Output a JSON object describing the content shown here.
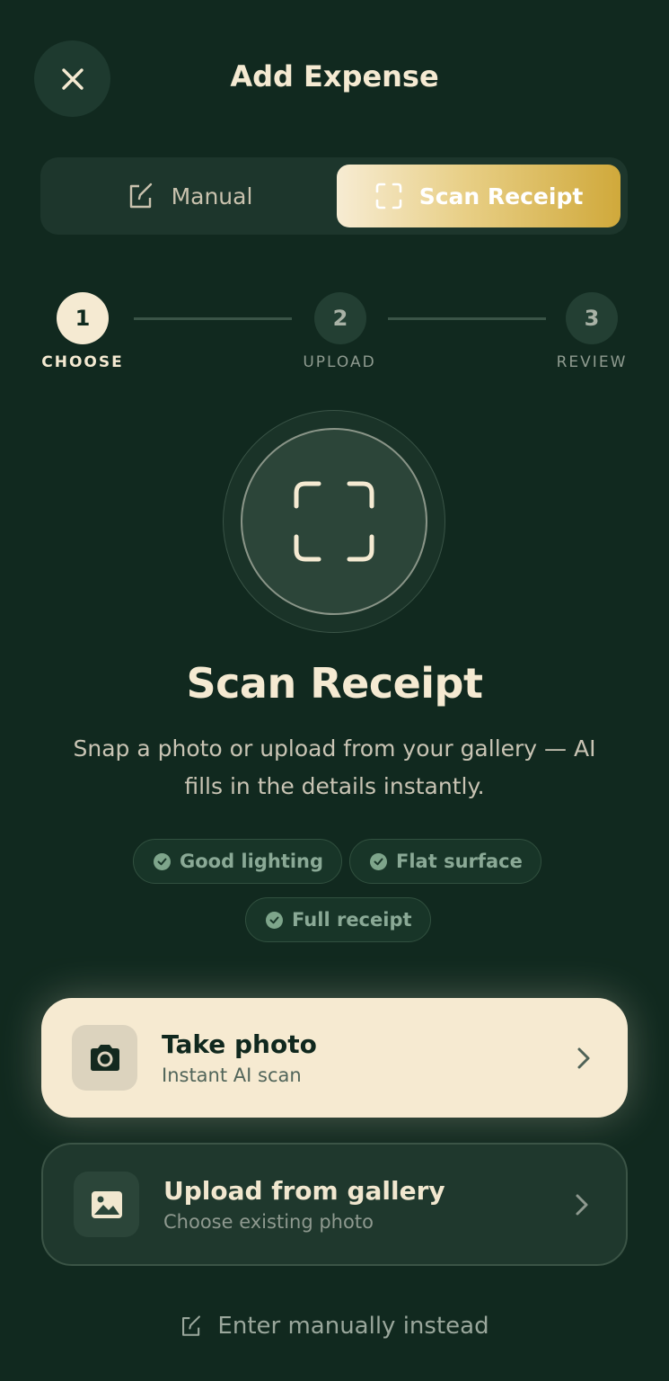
{
  "header": {
    "title": "Add Expense",
    "close_icon": "close-icon"
  },
  "segmented": {
    "manual_label": "Manual",
    "manual_icon": "edit-icon",
    "scan_label": "Scan Receipt",
    "scan_icon": "scan-frame-icon",
    "selected": "Scan Receipt"
  },
  "stepper": {
    "steps": [
      {
        "number": "1",
        "label": "CHOOSE",
        "active": true
      },
      {
        "number": "2",
        "label": "UPLOAD",
        "active": false
      },
      {
        "number": "3",
        "label": "REVIEW",
        "active": false
      }
    ]
  },
  "hero": {
    "icon": "scan-frame-icon",
    "title": "Scan Receipt",
    "description": "Snap a photo or upload from your gallery — AI fills in the details instantly."
  },
  "tips": [
    {
      "label": "Good lighting",
      "icon": "check-circle-icon"
    },
    {
      "label": "Flat surface",
      "icon": "check-circle-icon"
    },
    {
      "label": "Full receipt",
      "icon": "check-circle-icon"
    }
  ],
  "options": [
    {
      "title": "Take photo",
      "subtitle": "Instant AI scan",
      "icon": "camera-icon"
    },
    {
      "title": "Upload from gallery",
      "subtitle": "Choose existing photo",
      "icon": "image-icon"
    }
  ],
  "footer": {
    "manual_link": "Enter manually instead",
    "manual_icon": "edit-icon"
  },
  "colors": {
    "background": "#11291f",
    "cream": "#f5ead2",
    "gold": "#d0a93b"
  }
}
